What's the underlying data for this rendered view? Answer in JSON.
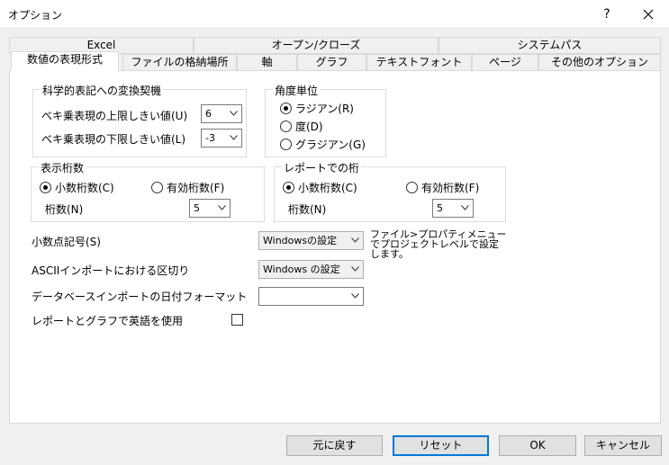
{
  "window": {
    "title": "オプション",
    "help_label": "?"
  },
  "tabs_row1": [
    {
      "label": "Excel"
    },
    {
      "label": "オープン/クローズ"
    },
    {
      "label": "システムパス"
    }
  ],
  "tabs_row2": [
    {
      "label": "数値の表現形式",
      "active": true
    },
    {
      "label": "ファイルの格納場所"
    },
    {
      "label": "軸"
    },
    {
      "label": "グラフ"
    },
    {
      "label": "テキストフォント"
    },
    {
      "label": "ページ"
    },
    {
      "label": "その他のオプション"
    }
  ],
  "sci": {
    "title": "科学的表記への変換契機",
    "upper_label": "べキ乗表現の上限しきい値(U)",
    "upper_value": "6",
    "lower_label": "べキ乗表現の下限しきい値(L)",
    "lower_value": "-3"
  },
  "angle": {
    "title": "角度単位",
    "options": [
      {
        "label": "ラジアン(R)",
        "selected": true
      },
      {
        "label": "度(D)",
        "selected": false
      },
      {
        "label": "グラジアン(G)",
        "selected": false
      }
    ]
  },
  "display_digits": {
    "title": "表示桁数",
    "decimal_label": "小数桁数(C)",
    "significant_label": "有効桁数(F)",
    "digits_label": "桁数(N)",
    "digits_value": "5"
  },
  "report_digits": {
    "title": "レポートでの桁",
    "decimal_label": "小数桁数(C)",
    "significant_label": "有効桁数(F)",
    "digits_label": "桁数(N)",
    "digits_value": "5"
  },
  "decimal_symbol": {
    "label": "小数点記号(S)",
    "value": "Windowsの設定",
    "note_line1": "ファイル>プロパティメニュー",
    "note_line2": "でプロジェクトレベルで設定",
    "note_line3": "します。"
  },
  "ascii_sep": {
    "label": "ASCIIインポートにおける区切り",
    "value": "Windows の設定"
  },
  "db_date": {
    "label": "データベースインポートの日付フォーマット",
    "value": ""
  },
  "english": {
    "label": "レポートとグラフで英語を使用",
    "checked": false
  },
  "buttons": {
    "revert": "元に戻す",
    "reset": "リセット",
    "ok": "OK",
    "cancel": "キャンセル"
  }
}
